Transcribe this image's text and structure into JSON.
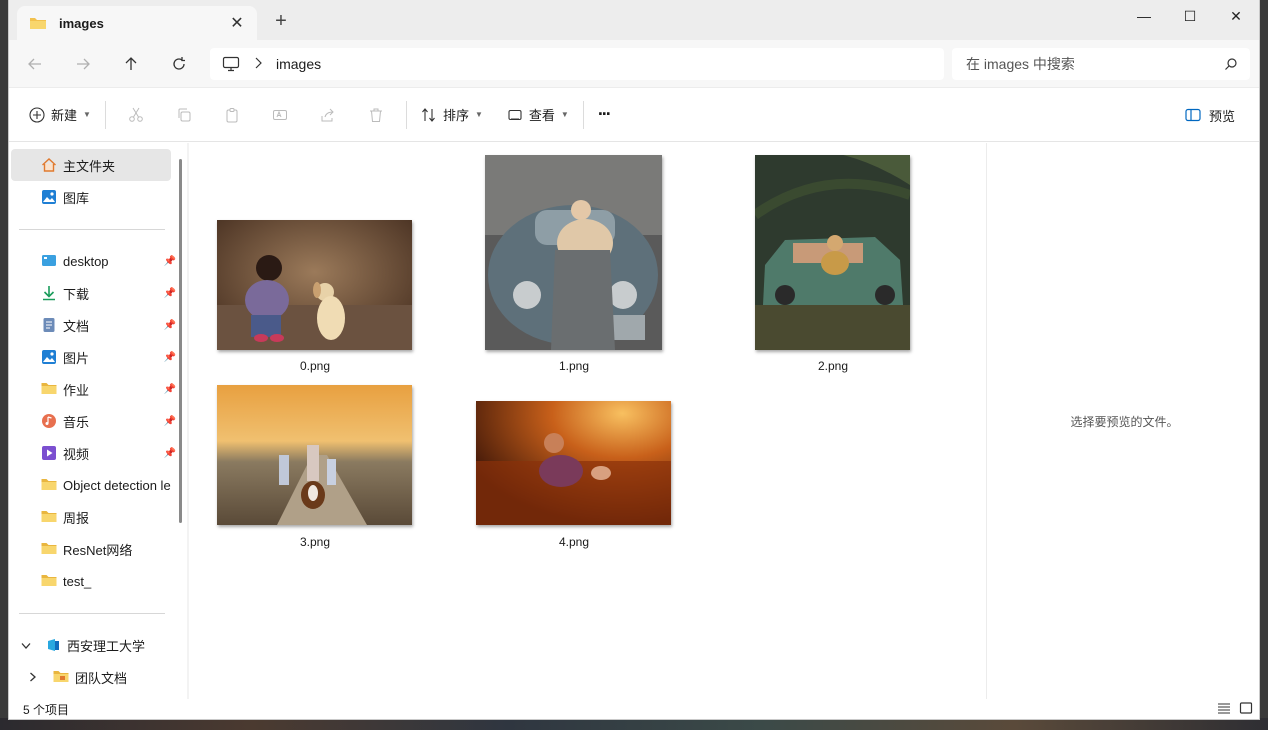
{
  "window": {
    "tab_title": "images",
    "new_tab": "+",
    "minimize": "—",
    "maximize": "☐",
    "close": "✕"
  },
  "address": {
    "crumb": "images",
    "search_placeholder": "在 images 中搜索"
  },
  "toolbar": {
    "new_label": "新建",
    "sort_label": "排序",
    "view_label": "查看",
    "more": "···",
    "preview_label": "预览"
  },
  "sidebar": {
    "home": "主文件夹",
    "gallery": "图库",
    "pinned": [
      {
        "label": "desktop",
        "icon": "desktop-icon"
      },
      {
        "label": "下载",
        "icon": "download-icon"
      },
      {
        "label": "文档",
        "icon": "document-icon"
      },
      {
        "label": "图片",
        "icon": "pictures-icon"
      },
      {
        "label": "作业",
        "icon": "folder-icon"
      },
      {
        "label": "音乐",
        "icon": "music-icon"
      },
      {
        "label": "视频",
        "icon": "video-icon"
      }
    ],
    "folders": [
      {
        "label": "Object detection le"
      },
      {
        "label": "周报"
      },
      {
        "label": "ResNet网络"
      },
      {
        "label": "test_"
      }
    ],
    "org": "西安理工大学",
    "team_docs": "团队文档"
  },
  "files": [
    {
      "name": "0.png"
    },
    {
      "name": "1.png"
    },
    {
      "name": "2.png"
    },
    {
      "name": "3.png"
    },
    {
      "name": "4.png"
    }
  ],
  "preview": {
    "message": "选择要预览的文件。"
  },
  "status": {
    "count": "5 个项目"
  },
  "colors": {
    "folder": "#f2c14e",
    "accent": "#0067c0",
    "selection": "#e6e6e6"
  }
}
